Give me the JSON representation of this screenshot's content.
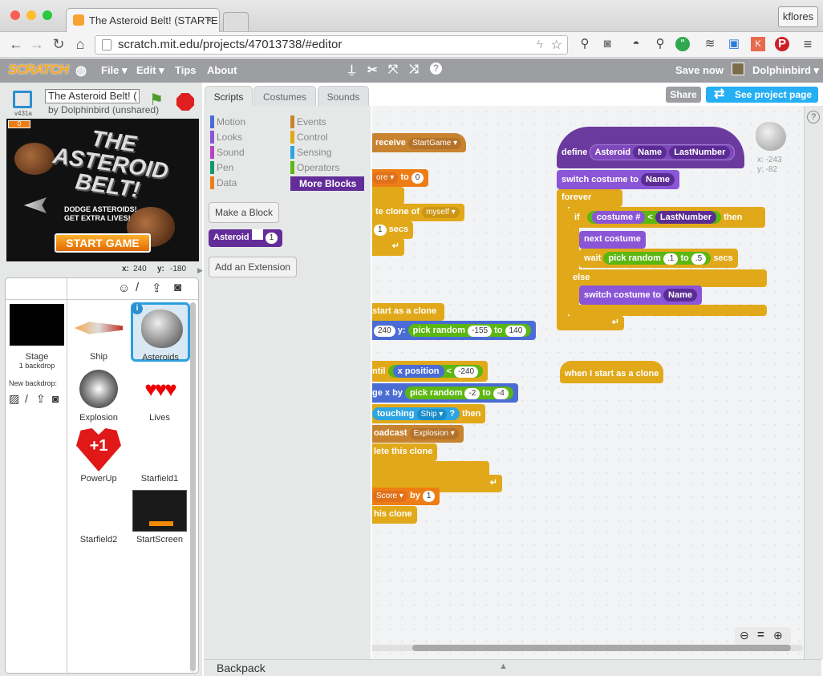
{
  "browser": {
    "tab_title": "The Asteroid Belt! (STARTE",
    "url": "scratch.mit.edu/projects/47013738/#editor",
    "user": "kflores"
  },
  "menubar": {
    "logo": "SCRATCH",
    "file": "File ▾",
    "edit": "Edit ▾",
    "tips": "Tips",
    "about": "About",
    "save_now": "Save now",
    "username": "Dolphinbird ▾"
  },
  "project": {
    "title": "The Asteroid Belt! (",
    "author": "by Dolphinbird (unshared)",
    "version": "v431a",
    "counter": "0",
    "mouse_x_label": "x:",
    "mouse_x": "240",
    "mouse_y_label": "y:",
    "mouse_y": "-180"
  },
  "stage_screen": {
    "title1": "THE ASTEROID",
    "title2": "BELT!",
    "line1": "DODGE ASTEROIDS!",
    "line2": "GET EXTRA LIVES!",
    "button": "START GAME"
  },
  "tabs": {
    "scripts": "Scripts",
    "costumes": "Costumes",
    "sounds": "Sounds"
  },
  "buttons": {
    "share": "Share",
    "see_project": "See project page"
  },
  "categories": {
    "motion": "Motion",
    "looks": "Looks",
    "sound": "Sound",
    "pen": "Pen",
    "data": "Data",
    "events": "Events",
    "control": "Control",
    "sensing": "Sensing",
    "operators": "Operators",
    "more_blocks": "More Blocks"
  },
  "palette": {
    "make_block": "Make a Block",
    "asteroid_block": "Asteroid",
    "asteroid_arg": "1",
    "add_extension": "Add an Extension"
  },
  "sprites_panel": {
    "stage_label": "Stage",
    "stage_sub": "1 backdrop",
    "new_backdrop": "New backdrop:",
    "sprites": [
      "Ship",
      "Asteroids",
      "Explosion",
      "Lives",
      "PowerUp",
      "Starfield1",
      "Starfield2",
      "StartScreen"
    ]
  },
  "sprite_coords": {
    "x": "x: -243",
    "y": "y: -82"
  },
  "scripts": {
    "define": "define",
    "def_name": "Asteroid",
    "def_arg1": "Name",
    "def_arg2": "LastNumber",
    "switch_costume": "switch costume to",
    "forever": "forever",
    "if": "if",
    "costume_num": "costume #",
    "lt": "<",
    "then": "then",
    "next_costume": "next costume",
    "wait": "wait",
    "pick_random": "pick random",
    "r_from": ".1",
    "to": "to",
    "r_to": ".5",
    "secs": "secs",
    "else": "else",
    "when_clone": "when I start as a clone",
    "receive": "receive",
    "startgame": "StartGame ▾",
    "core": "ore ▾",
    "to0": "0",
    "create_clone": "te clone of",
    "myself": "myself ▾",
    "one": "1",
    "start_clone": "start as a clone",
    "x240": "240",
    "y_label": "y:",
    "r_m155": "-155",
    "r_140": "140",
    "until": "ntil",
    "x_position": "x position",
    "m240": "-240",
    "change_x": "ge x by",
    "r_m2": "-2",
    "r_m4": "-4",
    "touching": "touching",
    "ship": "Ship ▾",
    "q": "?",
    "broadcast": "oadcast",
    "explosion": "Explosion ▾",
    "delete_clone": "lete this clone",
    "score": "Score ▾",
    "by": "by",
    "this_clone": "his clone"
  },
  "backpack": "Backpack",
  "colors": {
    "menubar": "#9c9ea2",
    "more_blocks": "#632d99",
    "share": "#9c9ea2",
    "see_project": "#25aff4"
  }
}
